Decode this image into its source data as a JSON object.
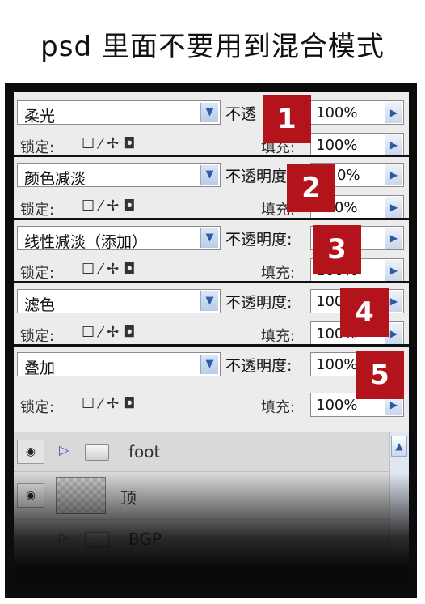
{
  "title": "psd 里面不要用到混合模式",
  "strips": [
    {
      "mode": "柔光",
      "opacity_label": "不透",
      "opacity": "100%",
      "badge": "1"
    },
    {
      "mode": "颜色减淡",
      "opacity_label": "不透明度",
      "opacity": "0%",
      "badge": "2"
    },
    {
      "mode": "线性减淡（添加）",
      "opacity_label": "不透明度:",
      "opacity": "",
      "badge": "3"
    },
    {
      "mode": "滤色",
      "opacity_label": "不透明度:",
      "opacity": "100",
      "badge": "4"
    },
    {
      "mode": "叠加",
      "opacity_label": "不透明度:",
      "opacity": "100%",
      "badge": "5"
    }
  ],
  "lock_row": {
    "lock_label": "锁定:",
    "fill_label": "填充:",
    "fill_value": "100%"
  },
  "layers": [
    {
      "name": "foot",
      "type": "folder"
    },
    {
      "name": "顶",
      "type": "layer"
    },
    {
      "name": "BGP",
      "type": "folder"
    }
  ],
  "colors": {
    "badge": "#b3131b",
    "frame": "#0c0c0c"
  },
  "icons": [
    "chevron-down-icon",
    "arrow-right-icon",
    "eye-icon",
    "folder-icon",
    "disclosure-triangle-icon",
    "lock-icon",
    "brush-icon",
    "move-icon",
    "transparency-icon",
    "scroll-up-icon"
  ]
}
